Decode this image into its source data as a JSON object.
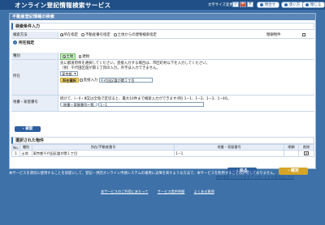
{
  "header": {
    "title": "オンライン登記情報検索サービス",
    "font_size_label": "文字サイズ変更",
    "font_sizes": [
      "小",
      "中",
      "大"
    ],
    "contact_label": "問合せ",
    "help_label": "使い方",
    "close_label": "閉じる"
  },
  "panel": {
    "title": "不動産登記情報の検索",
    "search_cond_heading": "検索条件入力",
    "search_method_label": "検索方法",
    "search_methods": [
      "所在指定",
      "不動産番号指定",
      "土地からの建物検索指定"
    ],
    "include_closed_label": "閉鎖物件",
    "location_heading": "所在指定",
    "type_label": "種別",
    "type_options": [
      "土地",
      "建物"
    ],
    "location_label": "所在",
    "location_help_1": "先に都道府県を選択してください。直接入力する場合は、市区町村以下を入力してください。",
    "location_help_2": "（例）千代田区霞が関１丁目の入力。外字は入力できません。",
    "prefecture_value": "東京都",
    "location_select_btn": "所在選択",
    "direct_input_label": "直接入力",
    "location_value": "千代田区霞が関１丁目",
    "parcel_label": "地番・家屋番号",
    "parcel_help": "続けて、Ⅰ・Ⅱ・Ⅲ又は全角で区切ると、最大10件まで検索入力ができます(例) 1−1、1−2、1−3、1−40。",
    "parcel_list_btn": "地番・家屋番号一覧",
    "parcel_value": "1−1",
    "search_button": "検索",
    "selected_heading": "選択された物件",
    "table_headers": [
      "No.",
      "種別",
      "所在/不動産番号",
      "地番・家屋番号",
      "閉鎖",
      "削除"
    ],
    "table_rows": [
      {
        "no": "1",
        "type": "土地",
        "location": "東京都千代田区霞が関１丁目",
        "parcel": "1−1",
        "closed": "",
        "delete": "✕"
      }
    ],
    "back_button": "戻る",
    "confirm_button": "確定",
    "link_text": "物件情報ファイルをダウンロードする場合はこちら"
  },
  "notice": {
    "text": "本サービスを適切に使用することを前提にして、登記・供託オンライン申請システムの運用に支障を来すような方法で、本サービスを利用することは許可しておりません。"
  },
  "footer": {
    "links": [
      "本サービスのご利用にあたって",
      "サービス提供時間",
      "よくある質問"
    ]
  },
  "colors": {
    "header_bg": "#1f4f86",
    "page_bg": "#3d71a8",
    "accent": "#2d6bb3",
    "confirm": "#d6a526"
  }
}
